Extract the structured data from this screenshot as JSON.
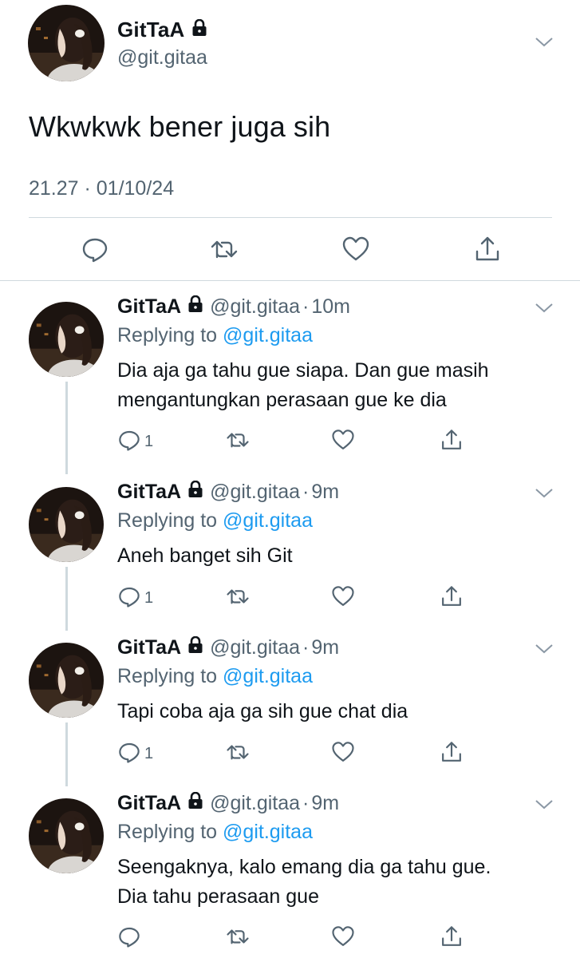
{
  "main_tweet": {
    "name": "GitTaA",
    "handle": "@git.gitaa",
    "text": "Wkwkwk bener juga sih",
    "timestamp": "21.27 · 01/10/24",
    "icons": [
      "reply-icon",
      "retweet-icon",
      "like-icon",
      "share-icon"
    ]
  },
  "replies": [
    {
      "name": "GitTaA",
      "handle": "@git.gitaa",
      "dot": "·",
      "time": "10m",
      "replying_prefix": "Replying to",
      "replying_to": "@git.gitaa",
      "lines": [
        "Dia aja ga tahu gue siapa. Dan gue masih",
        "mengantungkan perasaan gue ke dia"
      ],
      "reply_count": "1"
    },
    {
      "name": "GitTaA",
      "handle": "@git.gitaa",
      "dot": "·",
      "time": "9m",
      "replying_prefix": "Replying to",
      "replying_to": "@git.gitaa",
      "lines": [
        "Aneh banget sih Git"
      ],
      "reply_count": "1"
    },
    {
      "name": "GitTaA",
      "handle": "@git.gitaa",
      "dot": "·",
      "time": "9m",
      "replying_prefix": "Replying to",
      "replying_to": "@git.gitaa",
      "lines": [
        "Tapi coba aja ga sih gue chat dia"
      ],
      "reply_count": "1"
    },
    {
      "name": "GitTaA",
      "handle": "@git.gitaa",
      "dot": "·",
      "time": "9m",
      "replying_prefix": "Replying to",
      "replying_to": "@git.gitaa",
      "lines": [
        "Seengaknya, kalo emang dia ga tahu gue.",
        "Dia tahu perasaan gue"
      ],
      "reply_count": ""
    }
  ],
  "colors": {
    "text": "#0f1419",
    "secondary": "#536471",
    "link": "#1d9bf0",
    "divider": "#cfd9de"
  }
}
